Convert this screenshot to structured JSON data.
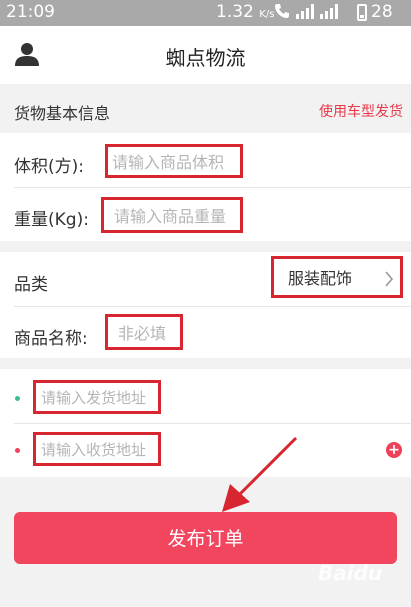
{
  "status_bar": {
    "time": "21:09",
    "speed_value": "1.32",
    "speed_unit": "K/s",
    "battery": "28"
  },
  "header": {
    "title": "蜘点物流",
    "user_icon": "user-icon"
  },
  "cargo_section": {
    "title": "货物基本信息",
    "vehicle_link": "使用车型发货"
  },
  "form": {
    "volume_label": "体积(方):",
    "volume_placeholder": "请输入商品体积",
    "weight_label": "重量(Kg):",
    "weight_placeholder": "请输入商品重量",
    "category_label": "品类",
    "category_value": "服装配饰",
    "product_name_label": "商品名称:",
    "product_name_placeholder": "非必填"
  },
  "addresses": {
    "ship_from_placeholder": "请输入发货地址",
    "ship_to_placeholder": "请输入收货地址",
    "ship_from_dot_color": "#3cbf8a",
    "ship_to_dot_color": "#ef4057"
  },
  "submit": {
    "label": "发布订单",
    "color": "#f2455e"
  },
  "annotation_color": "#d7262f",
  "watermark": "Baidu"
}
